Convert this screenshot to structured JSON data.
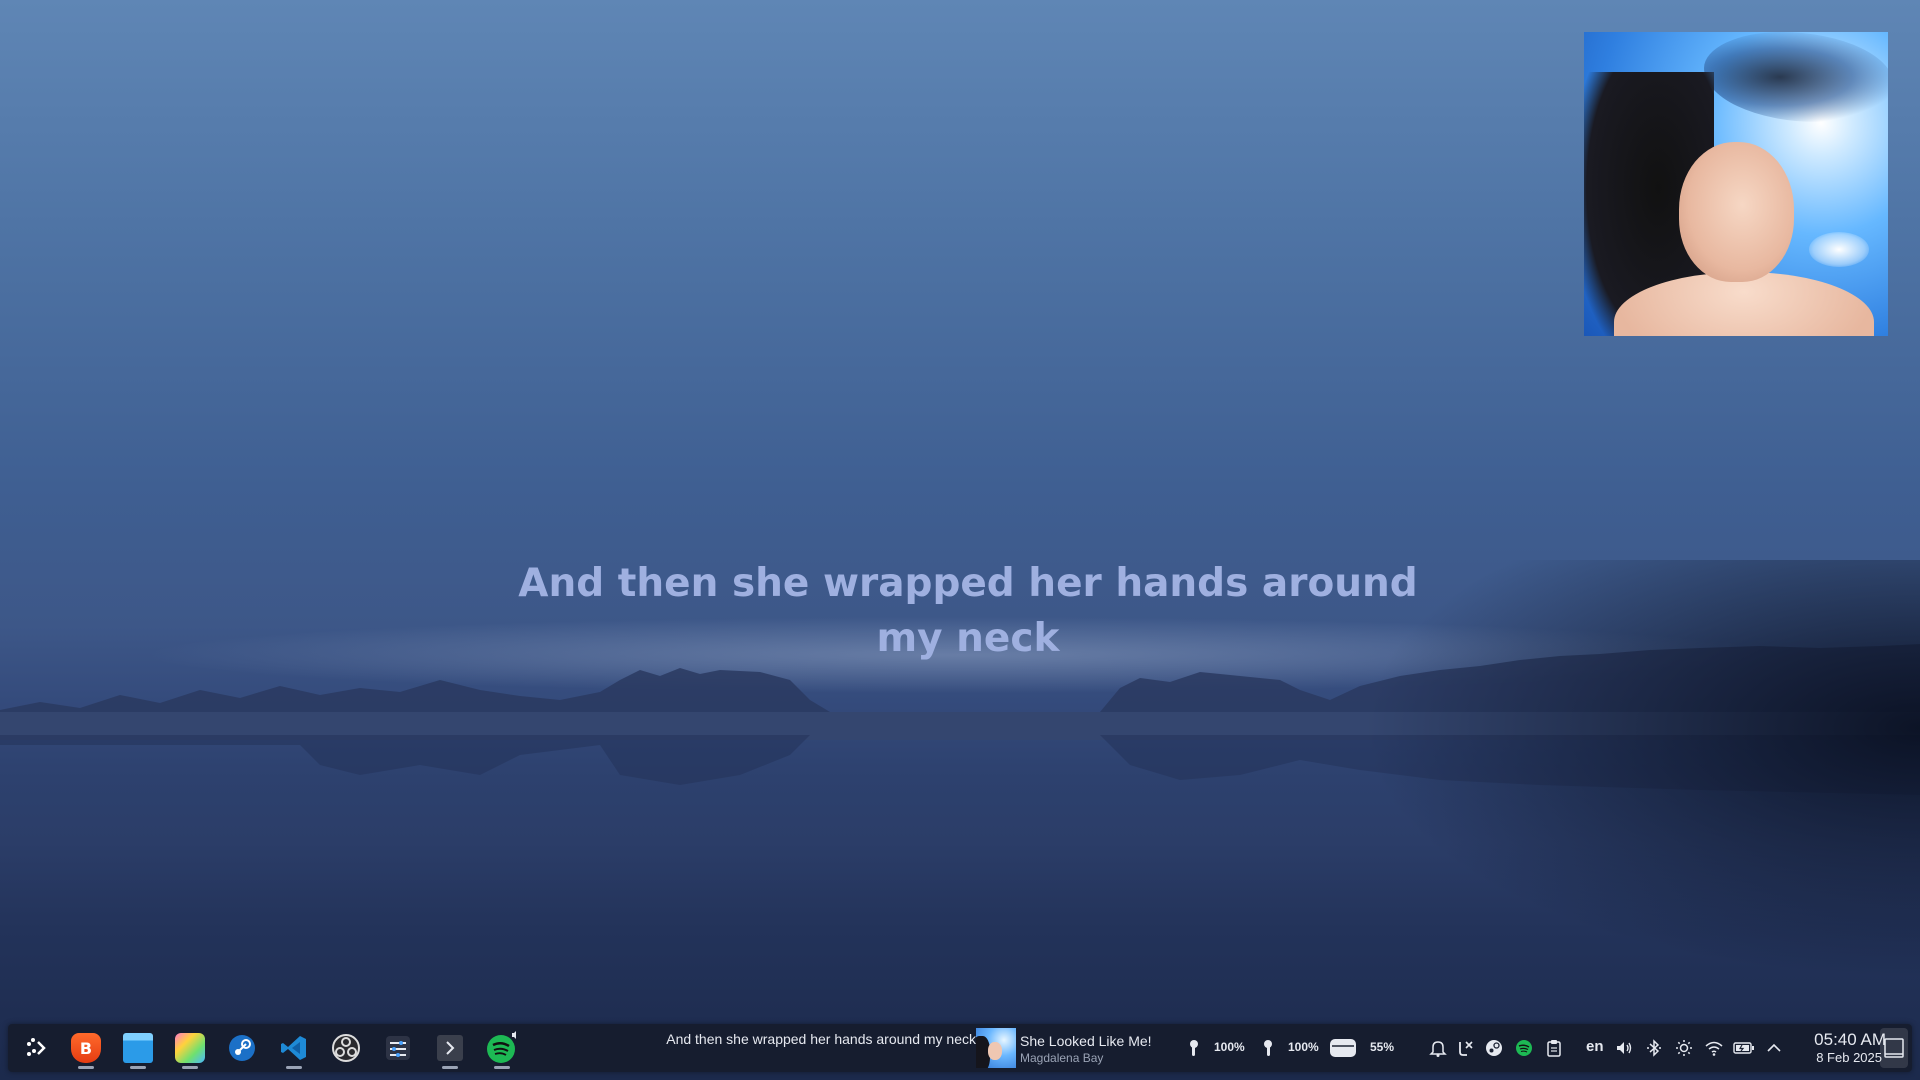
{
  "desktop": {
    "lyrics_line": "And then she wrapped her hands around my neck"
  },
  "album_art": {
    "icon": "album-cover-image"
  },
  "taskbar": {
    "launcher_icon": "application-launcher-icon",
    "apps": [
      {
        "name": "Brave Browser",
        "icon": "brave-icon",
        "running": true
      },
      {
        "name": "Files",
        "icon": "file-manager-icon",
        "running": true
      },
      {
        "name": "Color Picker",
        "icon": "color-app-icon",
        "running": true
      },
      {
        "name": "Steam",
        "icon": "steam-icon",
        "running": false
      },
      {
        "name": "Visual Studio Code",
        "icon": "vscode-icon",
        "running": true
      },
      {
        "name": "OBS Studio",
        "icon": "obs-icon",
        "running": false
      },
      {
        "name": "System Settings",
        "icon": "settings-sliders-icon",
        "running": false
      },
      {
        "name": "Terminal",
        "icon": "terminal-icon",
        "running": true
      },
      {
        "name": "Spotify",
        "icon": "spotify-icon",
        "running": true
      }
    ],
    "now_playing": {
      "lyric": "And then she wrapped her hands around my neck",
      "title": "She Looked Like Me!",
      "artist": "Magdalena Bay"
    },
    "device_status": [
      {
        "icon": "earbud-left-icon",
        "value": "100%"
      },
      {
        "icon": "earbud-right-icon",
        "value": "100%"
      },
      {
        "icon": "earbuds-case-icon",
        "value": "55%"
      }
    ],
    "tray": {
      "language": "en",
      "time": "05:40 AM",
      "date": "8 Feb 2025"
    }
  },
  "colors": {
    "lyrics": "#9fb0e0",
    "taskbar_bg": "#161c2c",
    "spotify_green": "#1db954"
  }
}
